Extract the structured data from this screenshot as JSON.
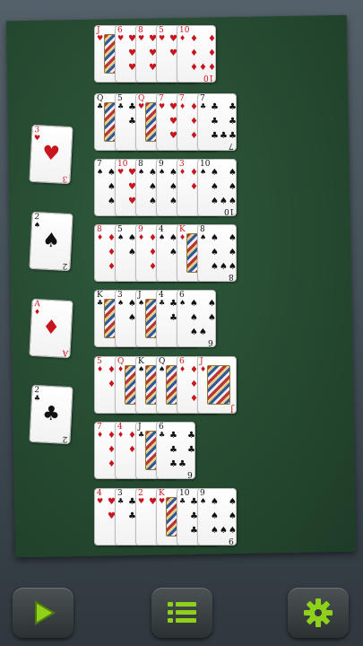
{
  "game": "solitaire",
  "foundations": [
    {
      "rank": "3",
      "suit": "♥",
      "color": "red"
    },
    {
      "rank": "2",
      "suit": "♠",
      "color": "black"
    },
    {
      "rank": "A",
      "suit": "♦",
      "color": "red"
    },
    {
      "rank": "2",
      "suit": "♣",
      "color": "black"
    }
  ],
  "tableau": [
    [
      {
        "rank": "J",
        "suit": "♥",
        "color": "red",
        "face": true
      },
      {
        "rank": "6",
        "suit": "♥",
        "color": "red"
      },
      {
        "rank": "8",
        "suit": "♥",
        "color": "red"
      },
      {
        "rank": "5",
        "suit": "♥",
        "color": "red"
      },
      {
        "rank": "10",
        "suit": "♦",
        "color": "red"
      }
    ],
    [
      {
        "rank": "Q",
        "suit": "♣",
        "color": "black",
        "face": true
      },
      {
        "rank": "5",
        "suit": "♣",
        "color": "black"
      },
      {
        "rank": "Q",
        "suit": "♥",
        "color": "red",
        "face": true
      },
      {
        "rank": "7",
        "suit": "♥",
        "color": "red"
      },
      {
        "rank": "7",
        "suit": "♦",
        "color": "red"
      },
      {
        "rank": "7",
        "suit": "♣",
        "color": "black"
      }
    ],
    [
      {
        "rank": "7",
        "suit": "♠",
        "color": "black"
      },
      {
        "rank": "10",
        "suit": "♥",
        "color": "red"
      },
      {
        "rank": "8",
        "suit": "♠",
        "color": "black"
      },
      {
        "rank": "9",
        "suit": "♠",
        "color": "black"
      },
      {
        "rank": "3",
        "suit": "♦",
        "color": "red"
      },
      {
        "rank": "10",
        "suit": "♠",
        "color": "black"
      }
    ],
    [
      {
        "rank": "8",
        "suit": "♦",
        "color": "red"
      },
      {
        "rank": "5",
        "suit": "♠",
        "color": "black"
      },
      {
        "rank": "9",
        "suit": "♦",
        "color": "red"
      },
      {
        "rank": "4",
        "suit": "♠",
        "color": "black"
      },
      {
        "rank": "K",
        "suit": "♦",
        "color": "red",
        "face": true
      },
      {
        "rank": "8",
        "suit": "♠",
        "color": "black"
      }
    ],
    [
      {
        "rank": "K",
        "suit": "♣",
        "color": "black",
        "face": true
      },
      {
        "rank": "3",
        "suit": "♠",
        "color": "black"
      },
      {
        "rank": "J",
        "suit": "♠",
        "color": "black",
        "face": true
      },
      {
        "rank": "4",
        "suit": "♣",
        "color": "black"
      },
      {
        "rank": "6",
        "suit": "♠",
        "color": "black"
      }
    ],
    [
      {
        "rank": "5",
        "suit": "♦",
        "color": "red"
      },
      {
        "rank": "Q",
        "suit": "♦",
        "color": "red",
        "face": true
      },
      {
        "rank": "K",
        "suit": "♠",
        "color": "black",
        "face": true
      },
      {
        "rank": "Q",
        "suit": "♠",
        "color": "black",
        "face": true
      },
      {
        "rank": "6",
        "suit": "♦",
        "color": "red"
      },
      {
        "rank": "J",
        "suit": "♦",
        "color": "red",
        "face": true
      }
    ],
    [
      {
        "rank": "7",
        "suit": "♦",
        "color": "red"
      },
      {
        "rank": "4",
        "suit": "♦",
        "color": "red"
      },
      {
        "rank": "J",
        "suit": "♣",
        "color": "black",
        "face": true
      },
      {
        "rank": "6",
        "suit": "♣",
        "color": "black"
      }
    ],
    [
      {
        "rank": "4",
        "suit": "♥",
        "color": "red"
      },
      {
        "rank": "3",
        "suit": "♣",
        "color": "black"
      },
      {
        "rank": "2",
        "suit": "♥",
        "color": "red"
      },
      {
        "rank": "K",
        "suit": "♥",
        "color": "red",
        "face": true
      },
      {
        "rank": "10",
        "suit": "♣",
        "color": "black"
      },
      {
        "rank": "9",
        "suit": "♠",
        "color": "black"
      }
    ]
  ],
  "toolbar": {
    "play_icon": "play-icon",
    "menu_icon": "menu-list-icon",
    "settings_icon": "gear-icon",
    "accent": "#8fd11a"
  }
}
